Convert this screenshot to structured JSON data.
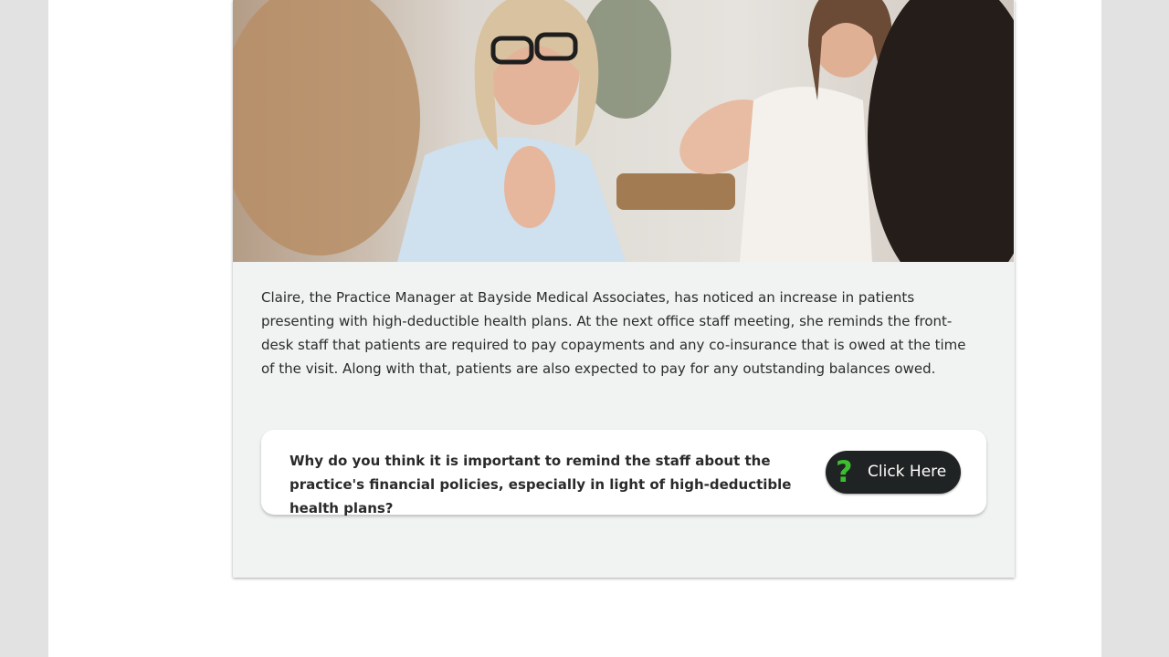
{
  "scenario": {
    "paragraph": "Claire, the Practice Manager at Bayside Medical Associates, has noticed an increase in patients presenting with high-deductible health plans. At the next office staff meeting, she reminds the front-desk staff that patients are required to pay copayments and any co-insurance that is owed at the time of the visit. Along with that, patients are also expected to pay for any outstanding balances owed."
  },
  "question": {
    "text": "Why do you think it is important to remind the staff about the practice's financial policies, especially in light of high-deductible health plans?",
    "button_label": "Click Here",
    "button_icon": "question-mark-icon",
    "icon_glyph": "?"
  },
  "colors": {
    "accent_green": "#3cbf2f",
    "button_bg": "#202323",
    "card_bg": "#f0f3f2"
  }
}
